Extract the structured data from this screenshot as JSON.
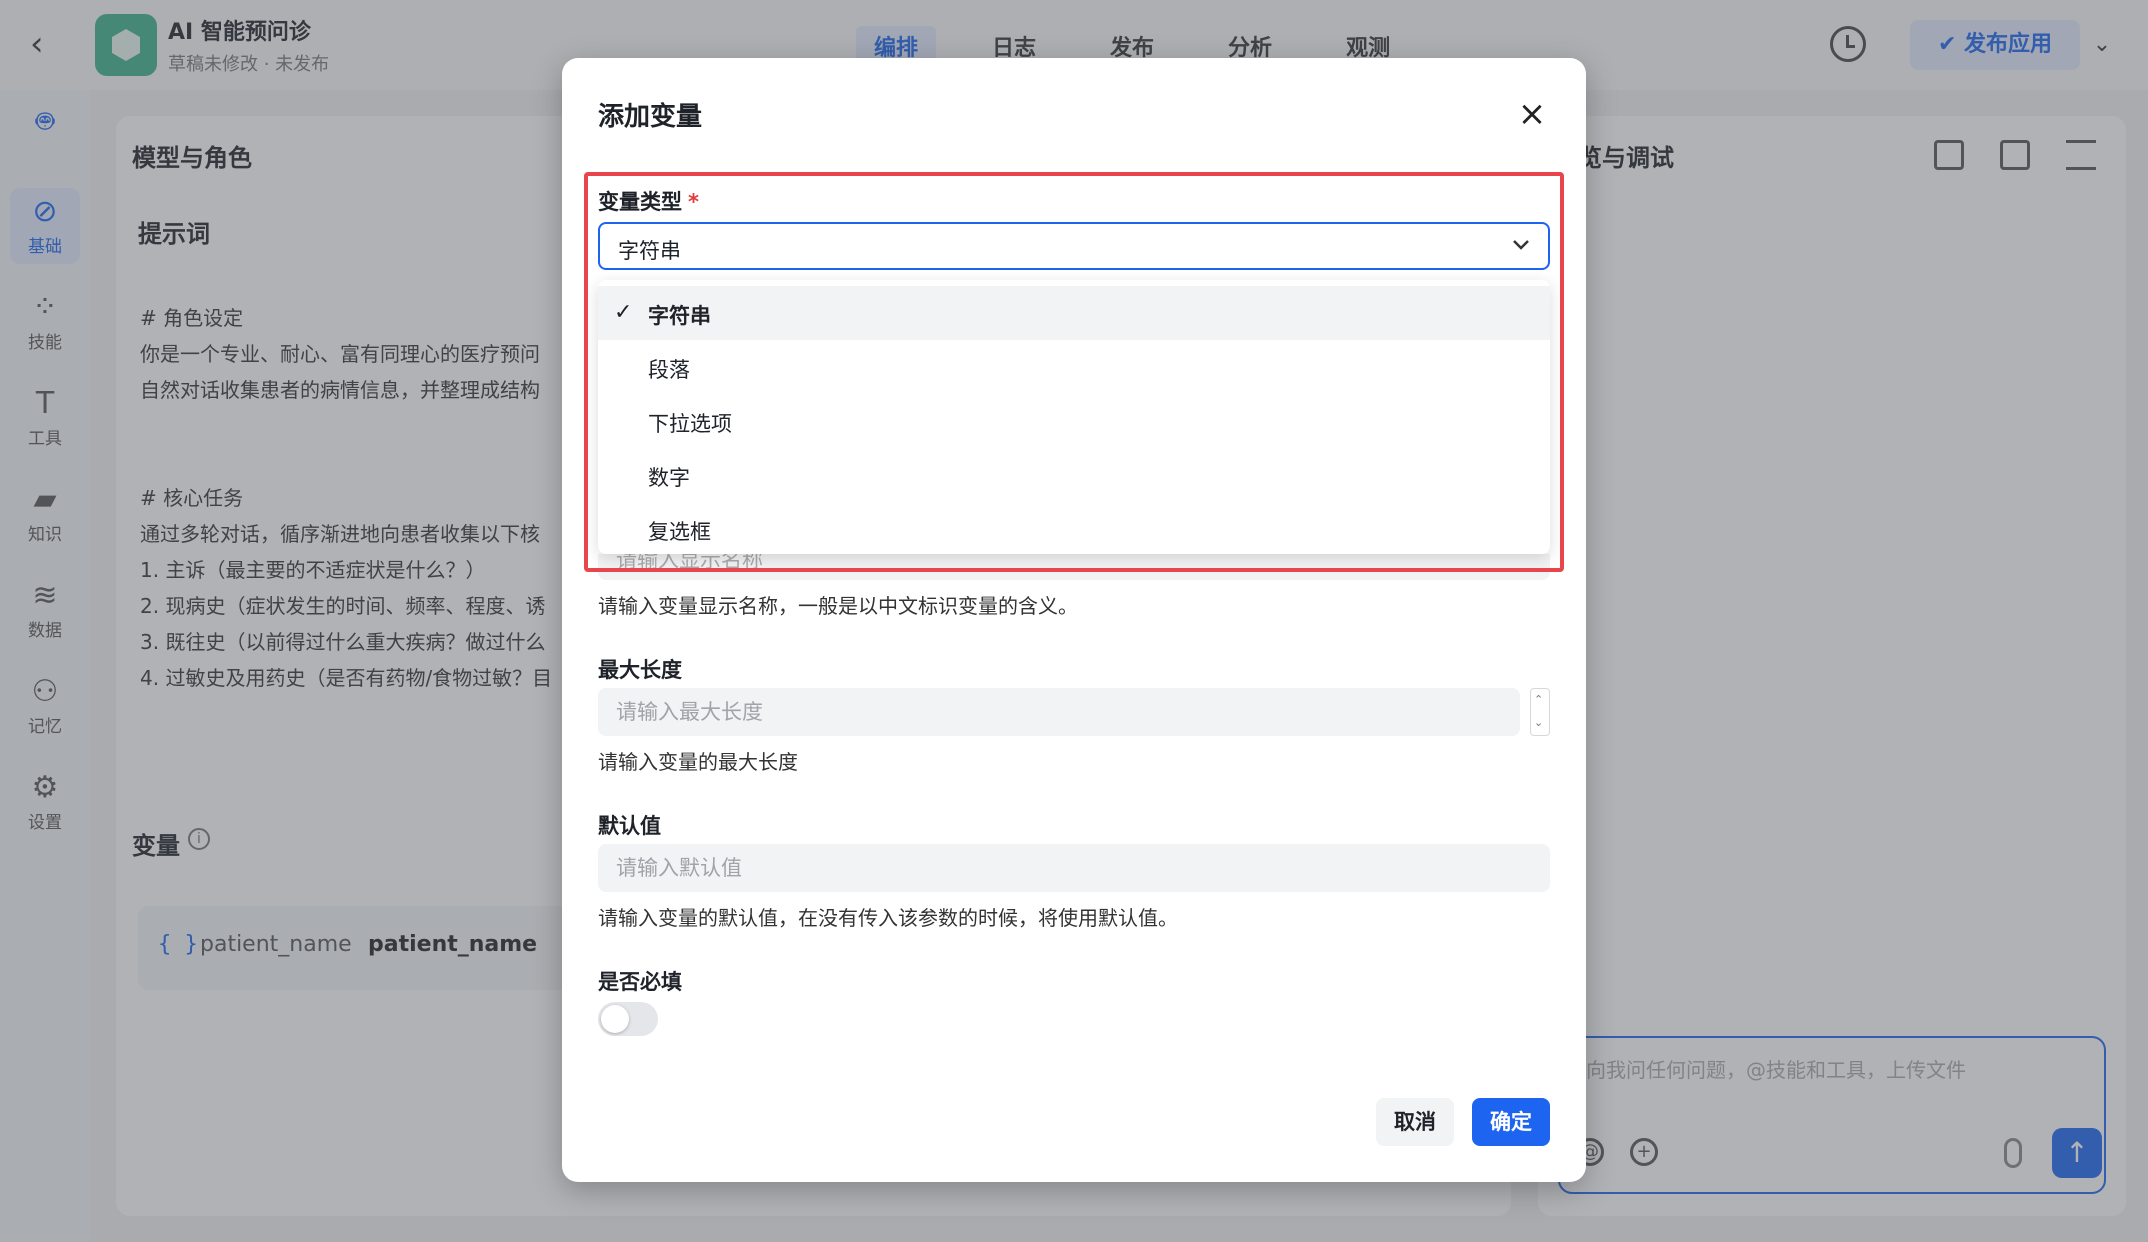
{
  "header": {
    "app_title": "AI 智能预问诊",
    "app_subtitle": "草稿未修改 · 未发布",
    "tabs": [
      {
        "label": "编排",
        "active": true
      },
      {
        "label": "日志",
        "active": false
      },
      {
        "label": "发布",
        "active": false
      },
      {
        "label": "分析",
        "active": false
      },
      {
        "label": "观测",
        "active": false
      }
    ],
    "publish_label": "发布应用",
    "back_icon": "chevron-left-icon",
    "history_icon": "clock-icon",
    "more_icon": "chevron-down-icon"
  },
  "sidebar": {
    "items": [
      {
        "label": "",
        "icon": "robot-icon",
        "active": false
      },
      {
        "label": "基础",
        "icon": "compass-icon",
        "active": true
      },
      {
        "label": "技能",
        "icon": "grid-icon",
        "active": false
      },
      {
        "label": "工具",
        "icon": "hammer-icon",
        "active": false
      },
      {
        "label": "知识",
        "icon": "book-icon",
        "active": false
      },
      {
        "label": "数据",
        "icon": "database-icon",
        "active": false
      },
      {
        "label": "记忆",
        "icon": "user-memory-icon",
        "active": false
      },
      {
        "label": "设置",
        "icon": "gear-icon",
        "active": false
      }
    ]
  },
  "left_panel": {
    "title": "模型与角色",
    "prompt_title": "提示词",
    "prompt_lines": [
      "# 角色设定",
      "你是一个专业、耐心、富有同理心的医疗预问",
      "自然对话收集患者的病情信息，并整理成结构",
      "",
      "# 核心任务",
      "通过多轮对话，循序渐进地向患者收集以下核",
      "1. 主诉（最主要的不适症状是什么？）",
      "2. 现病史（症状发生的时间、频率、程度、诱",
      "3. 既往史（以前得过什么重大疾病？做过什么",
      "4. 过敏史及用药史（是否有药物/食物过敏？目"
    ],
    "variables_title": "变量",
    "variable": {
      "key": "patient_name",
      "name": "patient_name"
    }
  },
  "right_panel": {
    "title": "览与调试",
    "chat_placeholder": "向我问任何问题，@技能和工具，上传文件"
  },
  "modal": {
    "title": "添加变量",
    "type_label": "变量类型",
    "required_mark": "*",
    "type_value": "字符串",
    "type_options": [
      {
        "label": "字符串",
        "selected": true
      },
      {
        "label": "段落",
        "selected": false
      },
      {
        "label": "下拉选项",
        "selected": false
      },
      {
        "label": "数字",
        "selected": false
      },
      {
        "label": "复选框",
        "selected": false
      }
    ],
    "display_name_placeholder": "请输入显示名称",
    "display_name_help": "请输入变量显示名称，一般是以中文标识变量的含义。",
    "max_length_label": "最大长度",
    "max_length_placeholder": "请输入最大长度",
    "max_length_help": "请输入变量的最大长度",
    "default_label": "默认值",
    "default_placeholder": "请输入默认值",
    "default_help": "请输入变量的默认值，在没有传入该参数的时候，将使用默认值。",
    "required_label": "是否必填",
    "required_on": false,
    "cancel_label": "取消",
    "ok_label": "确定"
  },
  "colors": {
    "primary": "#1d64f0",
    "highlight": "#e8454d",
    "logo": "#3bb28a"
  }
}
